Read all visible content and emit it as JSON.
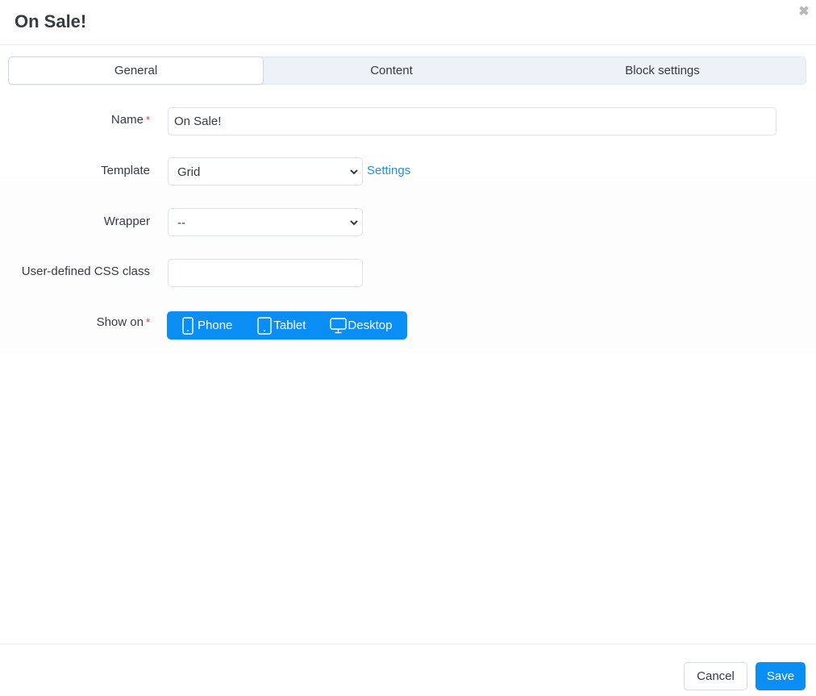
{
  "dialog": {
    "title": "On Sale!",
    "close_icon": "close-icon"
  },
  "tabs": [
    {
      "label": "General",
      "active": true
    },
    {
      "label": "Content",
      "active": false
    },
    {
      "label": "Block settings",
      "active": false
    }
  ],
  "form": {
    "name": {
      "label": "Name",
      "required_mark": "*",
      "value": "On Sale!"
    },
    "template": {
      "label": "Template",
      "selected": "Grid",
      "link_label": "Settings"
    },
    "wrapper": {
      "label": "Wrapper",
      "selected": "--"
    },
    "css_class": {
      "label": "User-defined CSS class",
      "value": ""
    },
    "show_on": {
      "label": "Show on",
      "required_mark": "*",
      "options": [
        {
          "label": "Phone",
          "icon": "phone-icon"
        },
        {
          "label": "Tablet",
          "icon": "tablet-icon"
        },
        {
          "label": "Desktop",
          "icon": "desktop-icon"
        }
      ]
    }
  },
  "footer": {
    "cancel_label": "Cancel",
    "save_label": "Save"
  },
  "colors": {
    "primary": "#0b8ef3",
    "link": "#1e90e4",
    "required": "#e8375e",
    "tab_bg": "#edf1f8"
  }
}
